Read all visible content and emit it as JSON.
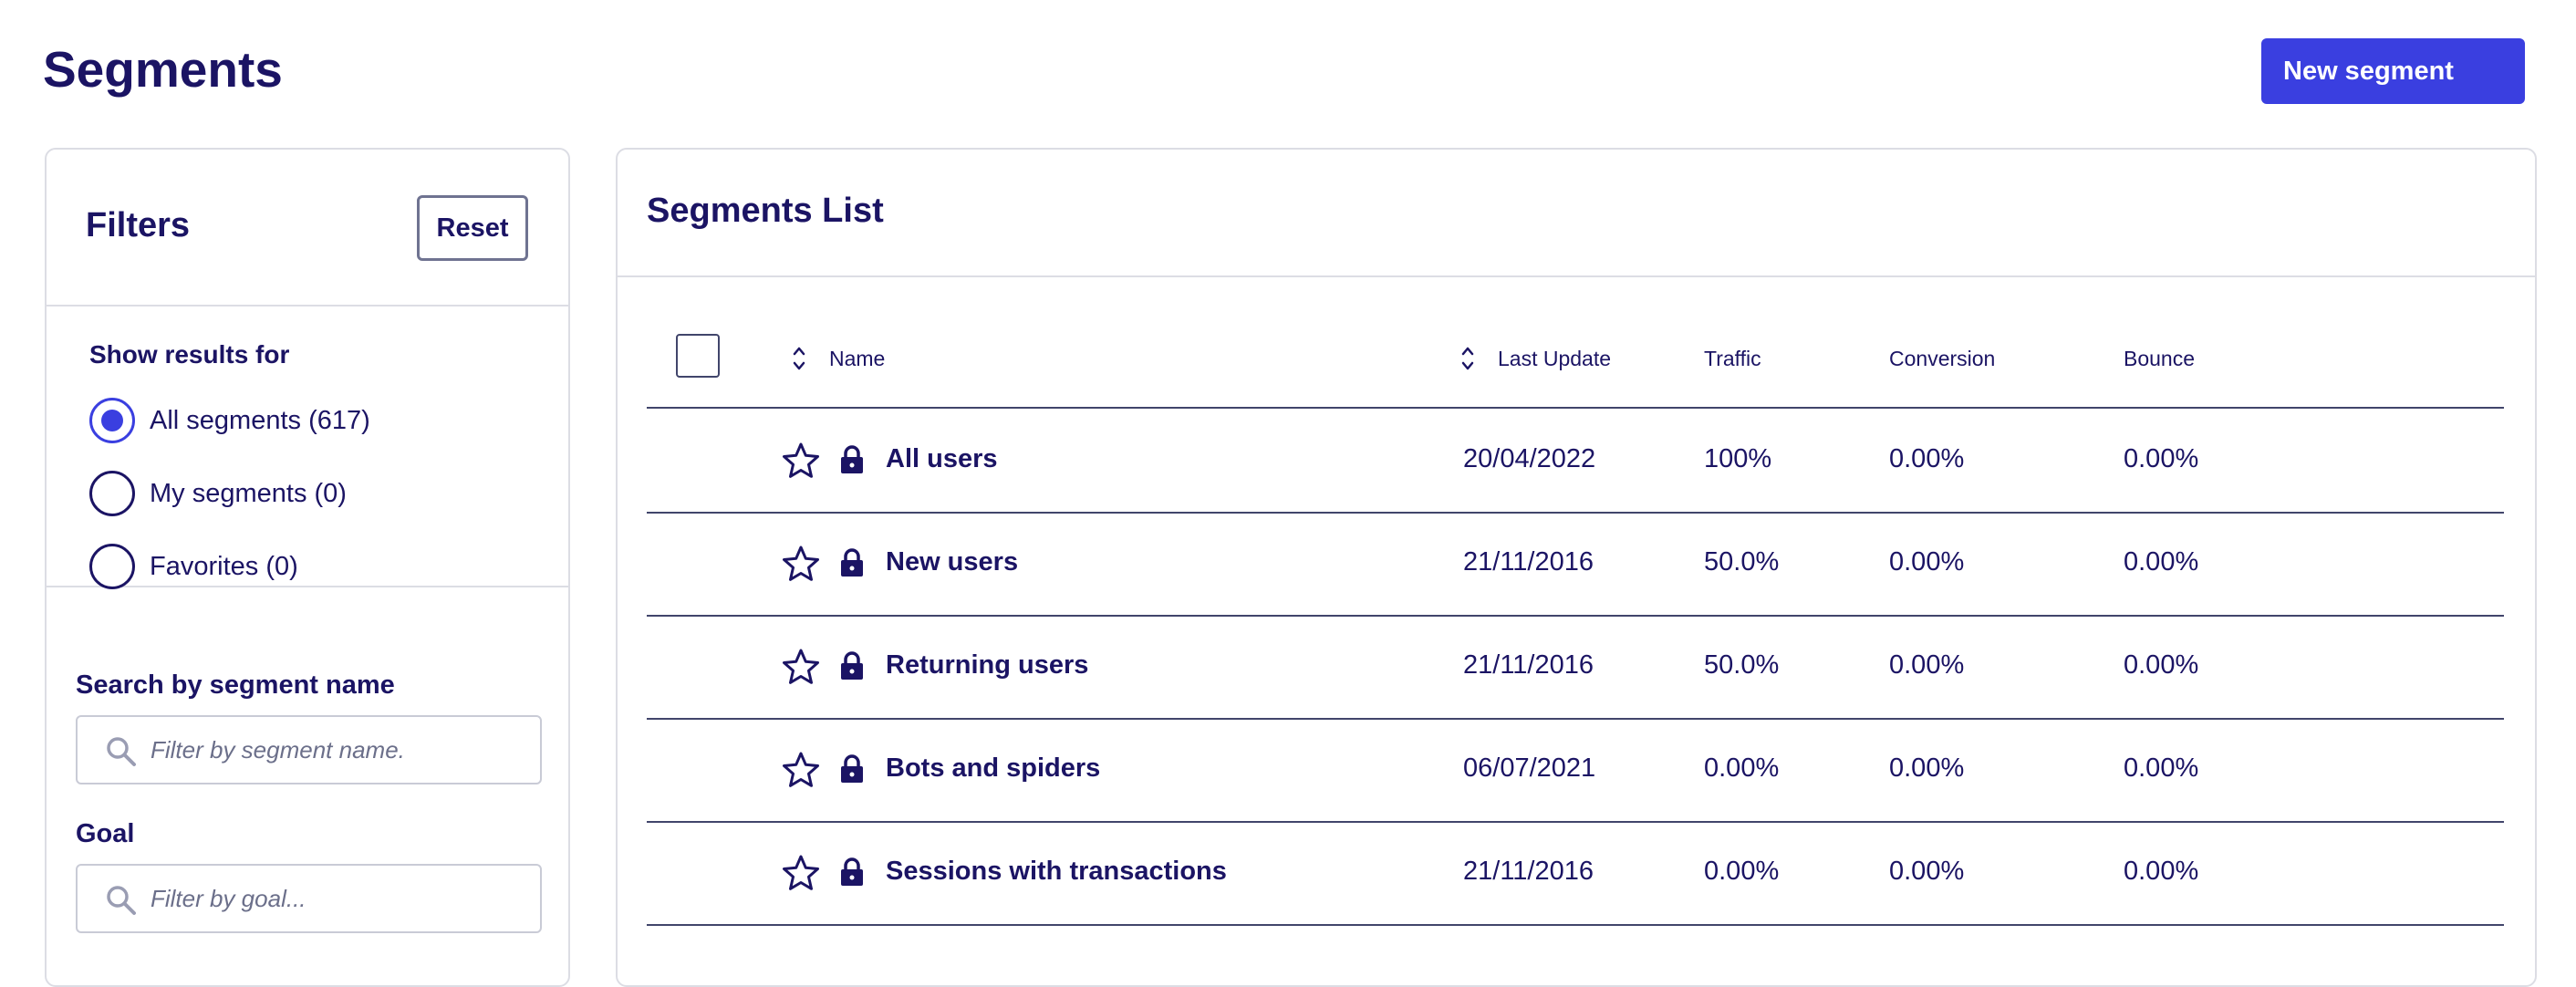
{
  "page": {
    "title": "Segments",
    "new_segment_label": "New segment"
  },
  "filters": {
    "title": "Filters",
    "reset_label": "Reset",
    "show_results_label": "Show results for",
    "options": [
      {
        "label": "All segments (617)",
        "checked": true
      },
      {
        "label": "My segments (0)",
        "checked": false
      },
      {
        "label": "Favorites (0)",
        "checked": false
      }
    ],
    "search_label": "Search by segment name",
    "search_placeholder": "Filter by segment name.",
    "goal_label": "Goal",
    "goal_placeholder": "Filter by goal..."
  },
  "list": {
    "title": "Segments List",
    "columns": {
      "name": "Name",
      "last_update": "Last Update",
      "traffic": "Traffic",
      "conversion": "Conversion",
      "bounce": "Bounce"
    },
    "rows": [
      {
        "name": "All users",
        "last_update": "20/04/2022",
        "traffic": "100%",
        "conversion": "0.00%",
        "bounce": "0.00%"
      },
      {
        "name": "New users",
        "last_update": "21/11/2016",
        "traffic": "50.0%",
        "conversion": "0.00%",
        "bounce": "0.00%"
      },
      {
        "name": "Returning users",
        "last_update": "21/11/2016",
        "traffic": "50.0%",
        "conversion": "0.00%",
        "bounce": "0.00%"
      },
      {
        "name": "Bots and spiders",
        "last_update": "06/07/2021",
        "traffic": "0.00%",
        "conversion": "0.00%",
        "bounce": "0.00%"
      },
      {
        "name": "Sessions with transactions",
        "last_update": "21/11/2016",
        "traffic": "0.00%",
        "conversion": "0.00%",
        "bounce": "0.00%"
      }
    ]
  },
  "colors": {
    "primary": "#3a3fe0",
    "text": "#1b1464",
    "border": "#dcdde4"
  },
  "icons": {
    "favorite": "star-icon",
    "locked": "lock-icon",
    "search": "search-icon",
    "sort": "sort-icon"
  }
}
